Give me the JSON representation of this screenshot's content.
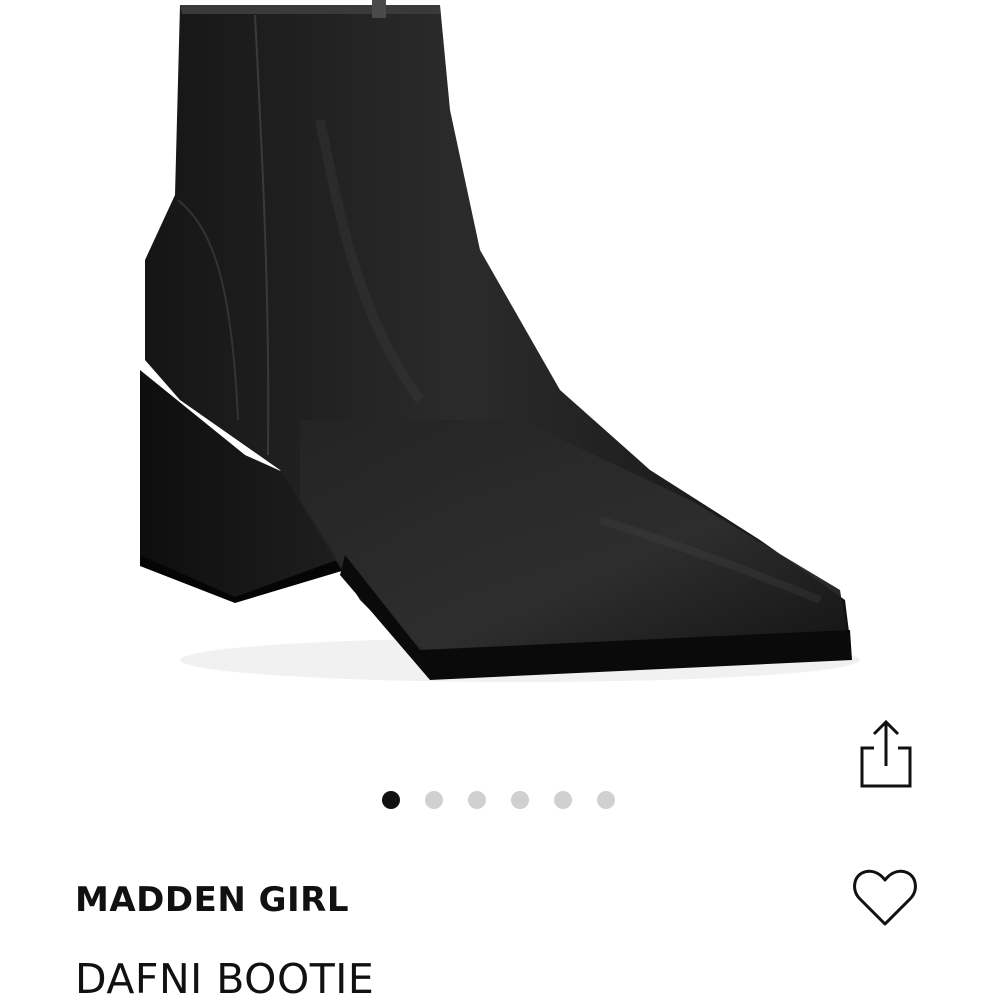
{
  "product": {
    "brand": "MADDEN GIRL",
    "name": "DAFNI BOOTIE"
  },
  "gallery": {
    "image_label": "black-ankle-bootie-photo",
    "slide_count": 6,
    "active_index": 0
  },
  "actions": {
    "share_icon": "share-icon",
    "favorite_icon": "heart-outline-icon"
  },
  "colors": {
    "text": "#111111",
    "dot_active": "#111111",
    "dot_inactive": "#d0d0d0",
    "boot": "#1c1c1c"
  }
}
